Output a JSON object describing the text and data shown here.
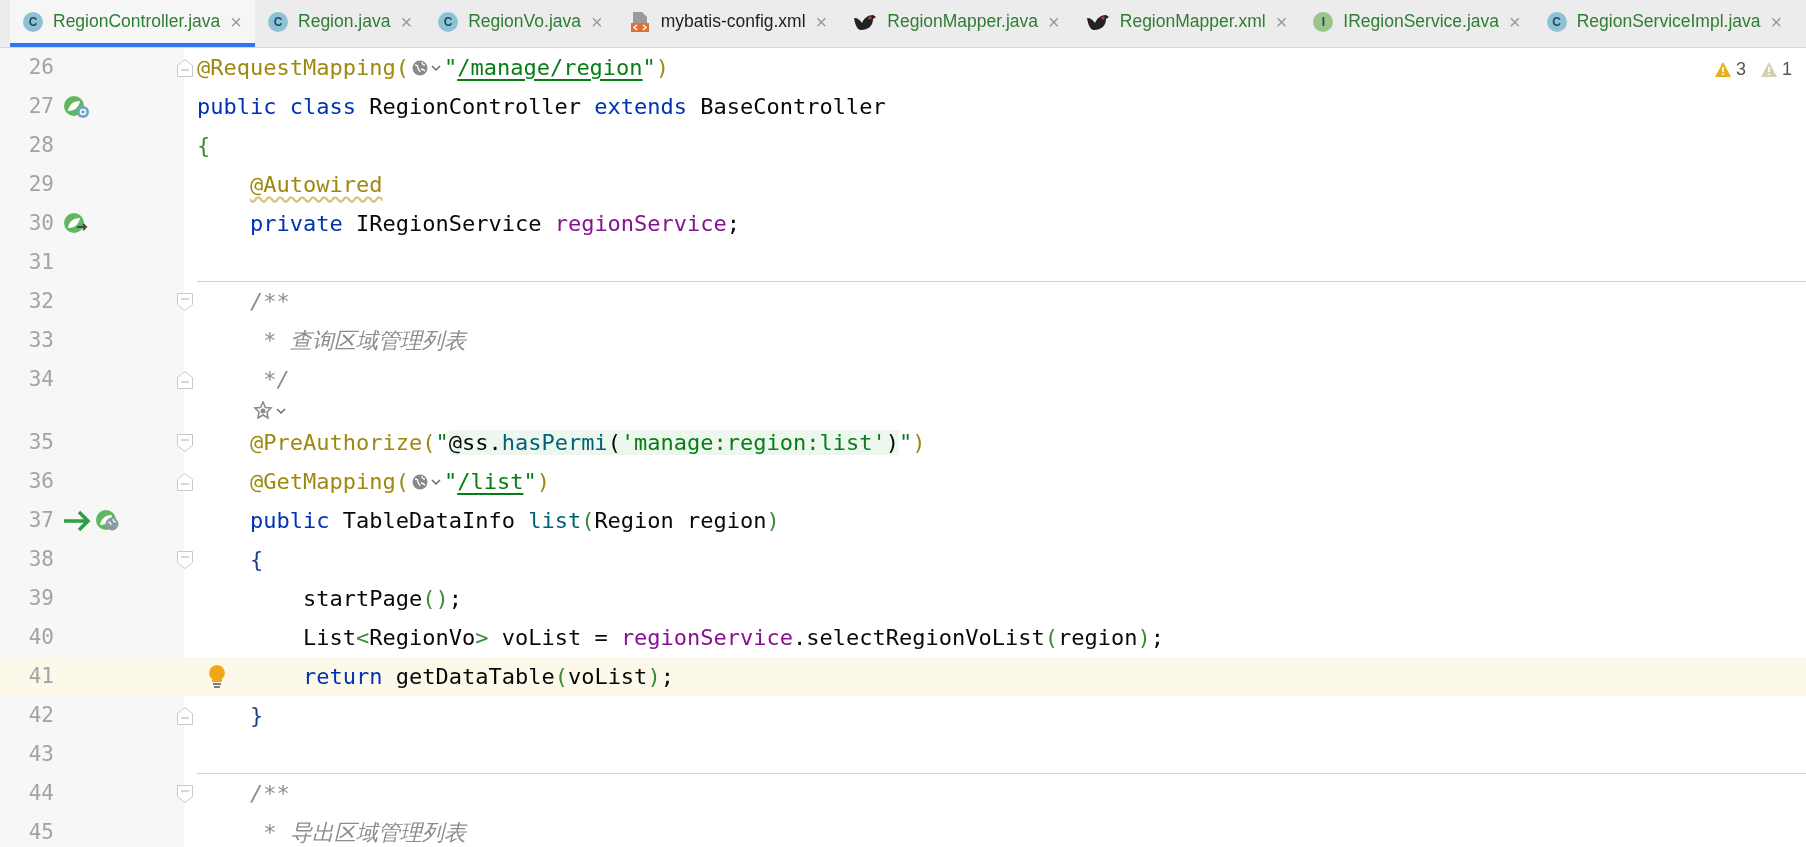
{
  "tabs": [
    {
      "label": "RegionController.java",
      "kind": "class",
      "badge": "C",
      "close": "×",
      "color": "#2e7d32",
      "selected": true
    },
    {
      "label": "Region.java",
      "kind": "class",
      "badge": "C",
      "close": "×",
      "color": "#2e7d32",
      "selected": false
    },
    {
      "label": "RegionVo.java",
      "kind": "class",
      "badge": "C",
      "close": "×",
      "color": "#2e7d32",
      "selected": false
    },
    {
      "label": "mybatis-config.xml",
      "kind": "xml",
      "close": "×",
      "color": "#1f1f1f",
      "selected": false
    },
    {
      "label": "RegionMapper.java",
      "kind": "bird",
      "close": "×",
      "color": "#2e7d32",
      "selected": false
    },
    {
      "label": "RegionMapper.xml",
      "kind": "bird",
      "close": "×",
      "color": "#2e7d32",
      "selected": false
    },
    {
      "label": "IRegionService.java",
      "kind": "interface",
      "badge": "I",
      "close": "×",
      "color": "#2e7d32",
      "selected": false
    },
    {
      "label": "RegionServiceImpl.java",
      "kind": "class",
      "badge": "C",
      "close": "×",
      "color": "#2e7d32",
      "selected": false
    }
  ],
  "inspections": [
    {
      "kind": "warning",
      "count": "3"
    },
    {
      "kind": "weak",
      "count": "1"
    }
  ],
  "lines": [
    {
      "kind": "code",
      "number": "26",
      "fold": {
        "kind": "end"
      },
      "current": false,
      "separator": false,
      "tokens": [
        {
          "kind": "annotation",
          "text": "@RequestMapping("
        },
        {
          "kind": "inlay"
        },
        {
          "kind": "string",
          "text": "\""
        },
        {
          "kind": "url",
          "text": "/manage/region"
        },
        {
          "kind": "string",
          "text": "\""
        },
        {
          "kind": "annotation",
          "text": ")"
        }
      ]
    },
    {
      "kind": "code",
      "number": "27",
      "icons": [
        {
          "kind": "bean"
        }
      ],
      "current": false,
      "separator": false,
      "tokens": [
        {
          "kind": "keyword",
          "text": "public class "
        },
        {
          "kind": "plain",
          "text": "RegionController "
        },
        {
          "kind": "keyword",
          "text": "extends "
        },
        {
          "kind": "plain",
          "text": "BaseController"
        }
      ]
    },
    {
      "kind": "code",
      "number": "28",
      "current": false,
      "separator": false,
      "tokens": [
        {
          "kind": "bracket",
          "text": "{"
        }
      ]
    },
    {
      "kind": "code",
      "number": "29",
      "current": false,
      "separator": false,
      "tokens": [
        {
          "kind": "warned",
          "text": "    @Autowired"
        }
      ]
    },
    {
      "kind": "code",
      "number": "30",
      "icons": [
        {
          "kind": "inject"
        }
      ],
      "current": false,
      "separator": false,
      "tokens": [
        {
          "kind": "keyword",
          "text": "    private "
        },
        {
          "kind": "plain",
          "text": "IRegionService "
        },
        {
          "kind": "field",
          "text": "regionService"
        },
        {
          "kind": "plain",
          "text": ";"
        }
      ]
    },
    {
      "kind": "code",
      "number": "31",
      "current": false,
      "separator": true
    },
    {
      "kind": "code",
      "number": "32",
      "fold": {
        "kind": "start"
      },
      "current": false,
      "separator": false,
      "tokens": [
        {
          "kind": "comment",
          "text": "    /**"
        }
      ]
    },
    {
      "kind": "code",
      "number": "33",
      "current": false,
      "separator": false,
      "tokens": [
        {
          "kind": "comment",
          "text": "     * 查询区域管理列表"
        }
      ]
    },
    {
      "kind": "code",
      "number": "34",
      "fold": {
        "kind": "end"
      },
      "current": false,
      "separator": false,
      "tokens": [
        {
          "kind": "comment",
          "text": "     */"
        }
      ]
    },
    {
      "kind": "hint"
    },
    {
      "kind": "code",
      "number": "35",
      "fold": {
        "kind": "start"
      },
      "current": false,
      "separator": false,
      "tokens": [
        {
          "kind": "annotation",
          "text": "    @PreAuthorize("
        },
        {
          "kind": "string",
          "text": "\""
        },
        {
          "kind": "spel",
          "text": "@ss."
        },
        {
          "kind": "spelcall",
          "text": "hasPermi"
        },
        {
          "kind": "spel",
          "text": "("
        },
        {
          "kind": "spelstr",
          "text": "'manage:region:list'"
        },
        {
          "kind": "spel",
          "text": ")"
        },
        {
          "kind": "string",
          "text": "\""
        },
        {
          "kind": "annotation",
          "text": ")"
        }
      ]
    },
    {
      "kind": "code",
      "number": "36",
      "fold": {
        "kind": "end"
      },
      "current": false,
      "separator": false,
      "tokens": [
        {
          "kind": "annotation",
          "text": "    @GetMapping("
        },
        {
          "kind": "inlay"
        },
        {
          "kind": "string",
          "text": "\""
        },
        {
          "kind": "url",
          "text": "/list"
        },
        {
          "kind": "string",
          "text": "\""
        },
        {
          "kind": "annotation",
          "text": ")"
        }
      ]
    },
    {
      "kind": "code",
      "number": "37",
      "icons": [
        {
          "kind": "arrow"
        },
        {
          "kind": "web"
        }
      ],
      "current": false,
      "separator": false,
      "tokens": [
        {
          "kind": "keyword",
          "text": "    public "
        },
        {
          "kind": "plain",
          "text": "TableDataInfo "
        },
        {
          "kind": "method",
          "text": "list"
        },
        {
          "kind": "bracket",
          "text": "("
        },
        {
          "kind": "plain",
          "text": "Region region"
        },
        {
          "kind": "bracket",
          "text": ")"
        }
      ]
    },
    {
      "kind": "code",
      "number": "38",
      "fold": {
        "kind": "start"
      },
      "current": false,
      "separator": false,
      "tokens": [
        {
          "kind": "brace",
          "text": "    {"
        }
      ]
    },
    {
      "kind": "code",
      "number": "39",
      "current": false,
      "separator": false,
      "tokens": [
        {
          "kind": "plain",
          "text": "        startPage"
        },
        {
          "kind": "bracket",
          "text": "()"
        },
        {
          "kind": "plain",
          "text": ";"
        }
      ]
    },
    {
      "kind": "code",
      "number": "40",
      "current": false,
      "separator": false,
      "tokens": [
        {
          "kind": "plain",
          "text": "        List"
        },
        {
          "kind": "bracket",
          "text": "<"
        },
        {
          "kind": "plain",
          "text": "RegionVo"
        },
        {
          "kind": "bracket",
          "text": ">"
        },
        {
          "kind": "plain",
          "text": " voList = "
        },
        {
          "kind": "field",
          "text": "regionService"
        },
        {
          "kind": "plain",
          "text": ".selectRegionVoList"
        },
        {
          "kind": "bracket",
          "text": "("
        },
        {
          "kind": "plain",
          "text": "region"
        },
        {
          "kind": "bracket",
          "text": ")"
        },
        {
          "kind": "plain",
          "text": ";"
        }
      ]
    },
    {
      "kind": "code",
      "number": "41",
      "bulb": true,
      "current": true,
      "separator": false,
      "tokens": [
        {
          "kind": "keyword",
          "text": "        return "
        },
        {
          "kind": "plain",
          "text": "getDataTable"
        },
        {
          "kind": "bracket",
          "text": "("
        },
        {
          "kind": "plain",
          "text": "voList"
        },
        {
          "kind": "bracket",
          "text": ")"
        },
        {
          "kind": "plain",
          "text": ";"
        }
      ]
    },
    {
      "kind": "code",
      "number": "42",
      "fold": {
        "kind": "end"
      },
      "current": false,
      "separator": false,
      "tokens": [
        {
          "kind": "brace",
          "text": "    }"
        }
      ]
    },
    {
      "kind": "code",
      "number": "43",
      "current": false,
      "separator": true
    },
    {
      "kind": "code",
      "number": "44",
      "fold": {
        "kind": "start"
      },
      "current": false,
      "separator": false,
      "tokens": [
        {
          "kind": "comment",
          "text": "    /**"
        }
      ]
    },
    {
      "kind": "code",
      "number": "45",
      "current": false,
      "separator": false,
      "tokens": [
        {
          "kind": "comment",
          "text": "     * 导出区域管理列表"
        }
      ]
    }
  ]
}
